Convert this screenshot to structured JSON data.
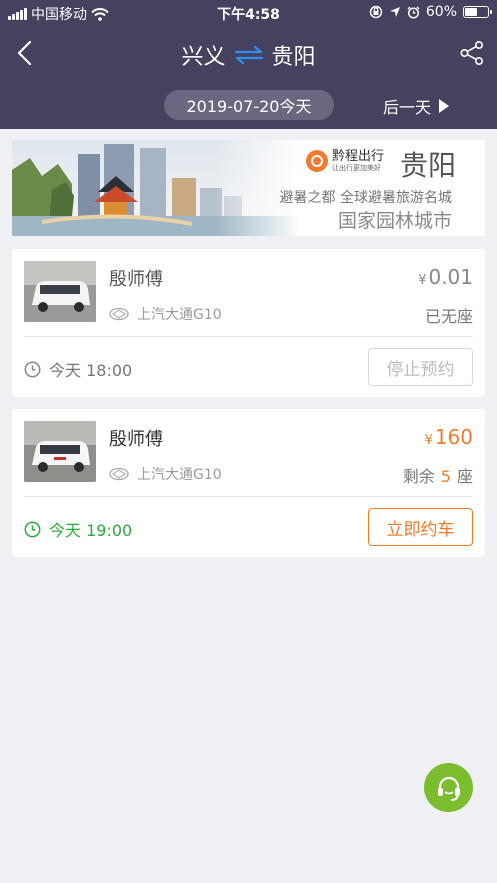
{
  "status_bar": {
    "carrier": "中国移动",
    "time": "下午4:58",
    "battery": "60%",
    "battery_level": 0.6
  },
  "nav": {
    "origin": "兴义",
    "destination": "贵阳"
  },
  "date_bar": {
    "date": "2019-07-20今天",
    "next_label": "后一天"
  },
  "banner": {
    "brand_name": "黔程出行",
    "brand_sub": "让出行更加美好",
    "city": "贵阳",
    "slogan_line1": "避暑之都 全球避暑旅游名城",
    "slogan_line2": "国家园林城市"
  },
  "trips": [
    {
      "driver": "殷师傅",
      "price_symbol": "¥",
      "price": "0.01",
      "vehicle": "上汽大通G10",
      "seat_text": "已无座",
      "time": "今天 18:00",
      "action": "停止预约"
    },
    {
      "driver": "殷师傅",
      "price_symbol": "¥",
      "price": "160",
      "vehicle": "上汽大通G10",
      "seat_prefix": "剩余",
      "seat_count": "5",
      "seat_suffix": "座",
      "time": "今天 19:00",
      "action": "立即约车"
    }
  ],
  "colors": {
    "header": "#44425e",
    "accent_orange": "#f07c2a",
    "available_green": "#2caa3e",
    "support_green": "#7bbd2f",
    "swap_blue": "#2f8ff0"
  },
  "icons": [
    "back-arrow-icon",
    "swap-arrows-icon",
    "share-icon",
    "clock-icon",
    "saic-logo-icon",
    "headset-icon"
  ]
}
